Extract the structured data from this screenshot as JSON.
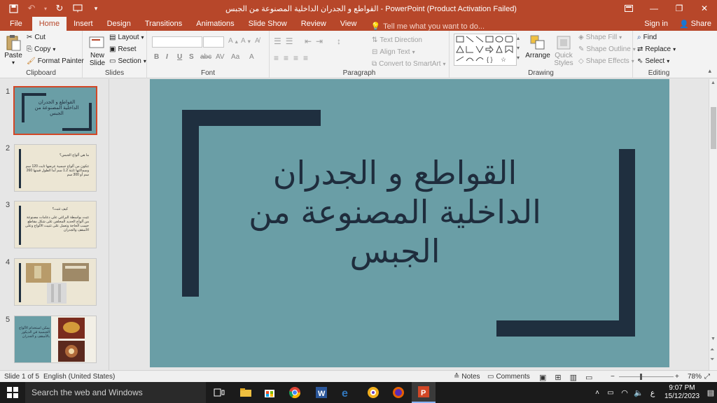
{
  "window": {
    "title": "القواطع و الجدران الداخلية المصنوعة من الجبس - PowerPoint (Product Activation Failed)"
  },
  "tabs": {
    "items": [
      "File",
      "Home",
      "Insert",
      "Design",
      "Transitions",
      "Animations",
      "Slide Show",
      "Review",
      "View"
    ],
    "active": "Home",
    "tell_me": "Tell me what you want to do...",
    "sign_in": "Sign in",
    "share": "Share"
  },
  "ribbon": {
    "clipboard": {
      "paste": "Paste",
      "cut": "Cut",
      "copy": "Copy",
      "format_painter": "Format Painter",
      "label": "Clipboard"
    },
    "slides": {
      "new_slide": "New Slide",
      "layout": "Layout",
      "reset": "Reset",
      "section": "Section",
      "label": "Slides"
    },
    "font": {
      "label": "Font"
    },
    "paragraph": {
      "text_direction": "Text Direction",
      "align_text": "Align Text",
      "smartart": "Convert to SmartArt",
      "label": "Paragraph"
    },
    "drawing": {
      "arrange": "Arrange",
      "quick_styles": "Quick Styles",
      "shape_fill": "Shape Fill",
      "shape_outline": "Shape Outline",
      "shape_effects": "Shape Effects",
      "label": "Drawing"
    },
    "editing": {
      "find": "Find",
      "replace": "Replace",
      "select": "Select",
      "label": "Editing"
    }
  },
  "thumbnails": {
    "numbers": [
      "1",
      "2",
      "3",
      "4",
      "5"
    ],
    "slide1_text": "القواطع و الجدران الداخلية المصنوعة من الجبس",
    "slide2_title": "ما هي ألواح الجبس؟",
    "slide2_body": "تتكون من ألواح جبسية عرضها ثابت 120 سم وسماكتها ثابتة 1.2 سم أما الطول فمنها 260 سم أو 300 سم",
    "slide3_title": "كيف تثبت؟",
    "slide3_body": "تثبت بواسطة البراغي على دعامات مصنوعة من ألواح الحديد المجلفن على شكل مقاطع حسب الحاجة وتعمل على تثبيت الألواح وعلى الأسقف والجدران",
    "slide5_text": "يمكن استخدام الألواح الجبسية في الديكور بالأسقف و الجدران"
  },
  "slide": {
    "title": "القواطع و الجدران الداخلية المصنوعة من الجبس"
  },
  "status": {
    "slide_info": "Slide 1 of 5",
    "language": "English (United States)",
    "notes": "Notes",
    "comments": "Comments",
    "zoom": "78%"
  },
  "taskbar": {
    "search": "Search the web and Windows",
    "time": "9:07 PM",
    "date": "15/12/2023",
    "lang": "ع"
  },
  "colors": {
    "accent": "#b7472a",
    "slide_bg": "#6a9ea6",
    "frame": "#1f2f3f"
  }
}
